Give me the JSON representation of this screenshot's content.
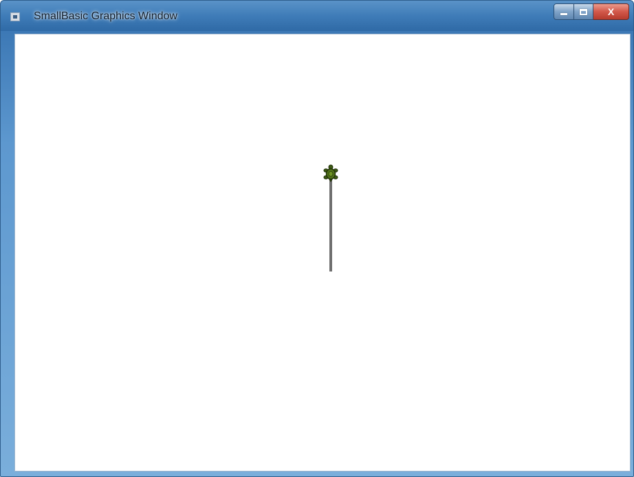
{
  "window": {
    "title": "SmallBasic Graphics Window",
    "app_icon": "smallbasic-window-icon",
    "buttons": {
      "minimize_icon": "minimize-icon",
      "maximize_icon": "maximize-icon",
      "close_label": "X"
    }
  },
  "canvas": {
    "background": "#ffffff",
    "turtle": {
      "icon": "turtle-icon",
      "color": "#3d5a12",
      "heading": "up"
    },
    "trail_color": "#6f6f6f"
  },
  "colors": {
    "titlebar": "#3f7cb8",
    "close_button": "#d2584a"
  }
}
